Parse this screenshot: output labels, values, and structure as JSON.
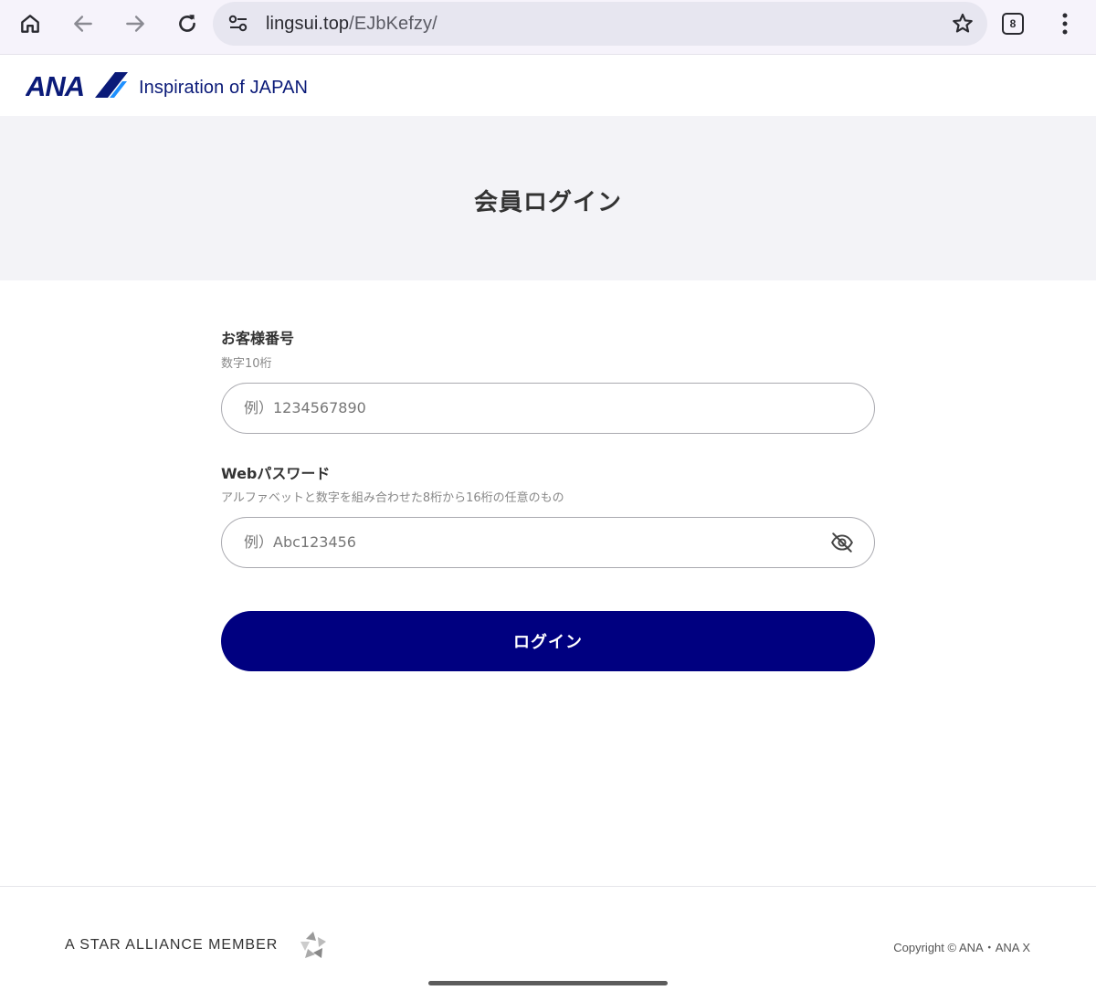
{
  "browser": {
    "url_host": "lingsui.top",
    "url_path": "/EJbKefzy/",
    "tab_count": "8"
  },
  "header": {
    "logo_text": "ANA",
    "tagline": "Inspiration of JAPAN"
  },
  "page": {
    "title": "会員ログイン"
  },
  "form": {
    "customer_number": {
      "label": "お客様番号",
      "help": "数字10桁",
      "placeholder": "例）1234567890",
      "value": ""
    },
    "password": {
      "label": "Webパスワード",
      "help": "アルファベットと数字を組み合わせた8桁から16桁の任意のもの",
      "placeholder": "例）Abc123456",
      "value": ""
    },
    "submit_label": "ログイン"
  },
  "footer": {
    "alliance_text": "A STAR ALLIANCE MEMBER",
    "copyright": "Copyright © ANA・ANA X"
  },
  "colors": {
    "brand_navy": "#000080",
    "title_band": "#f3f3f7",
    "tagline": "#0a1a78"
  }
}
